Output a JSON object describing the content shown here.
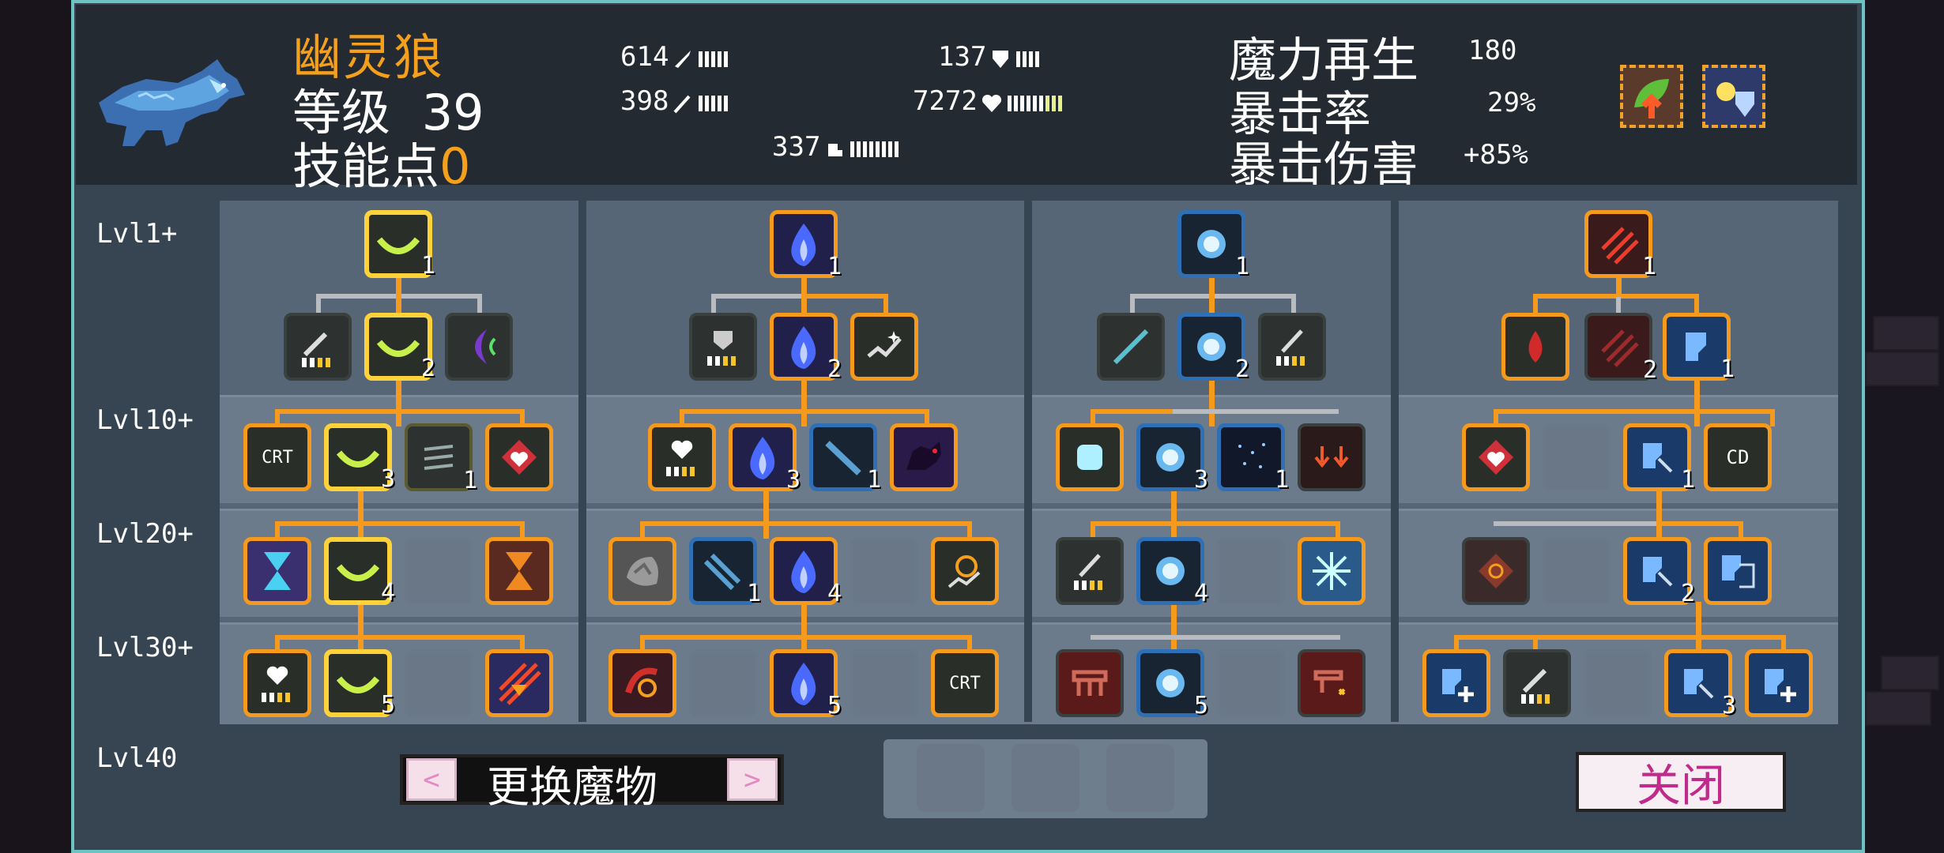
{
  "monster": {
    "name": "幽灵狼",
    "level_label": "等级",
    "level": "39",
    "skill_points_label": "技能点",
    "skill_points": "0"
  },
  "stats": {
    "attack": "614",
    "magic": "398",
    "defense": "137",
    "hp": "7272",
    "speed": "337",
    "regen_label": "魔力再生",
    "regen": "180",
    "crit_label": "暴击率",
    "crit": "29%",
    "critdmg_label": "暴击伤害",
    "critdmg": "+85%"
  },
  "levels": [
    "Lvl1+",
    "Lvl10+",
    "Lvl20+",
    "Lvl30+",
    "Lvl40"
  ],
  "buttons": {
    "switch": "更换魔物",
    "close": "关闭",
    "prev": "<",
    "next": ">"
  },
  "node_labels": {
    "crt": "CRT",
    "cd": "CD"
  },
  "counts": {
    "a1": "1",
    "a2": "2",
    "a3": "3",
    "a3b": "1",
    "a4": "4",
    "a5": "5",
    "b1": "1",
    "b2": "2",
    "b3": "3",
    "b3b": "1",
    "b4": "4",
    "b4b": "1",
    "b5": "5",
    "c1": "1",
    "c2": "2",
    "c3": "3",
    "c3b": "1",
    "c4": "4",
    "c5": "5",
    "d1": "1",
    "d2b": "2",
    "d2": "1",
    "d3": "1",
    "d4": "2",
    "d5": "3"
  },
  "colors": {
    "accent_orange": "#f59a1c",
    "selected_yellow": "#ffd23a",
    "frame_teal": "#6dc3c2",
    "name_orange": "#f5a01c"
  }
}
